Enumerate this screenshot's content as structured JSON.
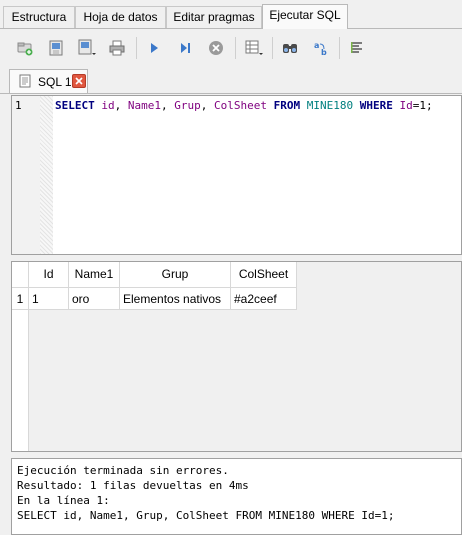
{
  "main_tabs": [
    {
      "label": "Estructura"
    },
    {
      "label": "Hoja de datos"
    },
    {
      "label": "Editar pragmas"
    },
    {
      "label": "Ejecutar SQL",
      "active": true
    }
  ],
  "toolbar": {
    "icons": [
      "open-tab-icon",
      "open-sql-icon",
      "save-sql-icon",
      "print-icon",
      "execute-all-icon",
      "execute-line-icon",
      "stop-icon",
      "save-results-icon",
      "find-icon",
      "find-replace-icon",
      "comment-icon"
    ]
  },
  "sql_tab": {
    "label": "SQL 1"
  },
  "editor": {
    "line_number": "1",
    "tokens": [
      {
        "t": "SELECT",
        "c": "kw"
      },
      {
        "t": " ",
        "c": "pl"
      },
      {
        "t": "id",
        "c": "id"
      },
      {
        "t": ", ",
        "c": "pl"
      },
      {
        "t": "Name1",
        "c": "id"
      },
      {
        "t": ", ",
        "c": "pl"
      },
      {
        "t": "Grup",
        "c": "id"
      },
      {
        "t": ", ",
        "c": "pl"
      },
      {
        "t": "ColSheet",
        "c": "id"
      },
      {
        "t": " ",
        "c": "pl"
      },
      {
        "t": "FROM",
        "c": "kw"
      },
      {
        "t": " ",
        "c": "pl"
      },
      {
        "t": "MINE180",
        "c": "tbl"
      },
      {
        "t": " ",
        "c": "pl"
      },
      {
        "t": "WHERE",
        "c": "kw"
      },
      {
        "t": " ",
        "c": "pl"
      },
      {
        "t": "Id",
        "c": "id"
      },
      {
        "t": "=1;",
        "c": "pl"
      }
    ]
  },
  "results": {
    "columns": [
      "Id",
      "Name1",
      "Grup",
      "ColSheet"
    ],
    "rows": [
      {
        "row_number": "1",
        "cells": [
          "1",
          "oro",
          "Elementos nativos",
          "#a2ceef"
        ]
      }
    ]
  },
  "messages": [
    "Ejecución terminada sin errores.",
    "Resultado: 1 filas devueltas en 4ms",
    "En la línea 1:",
    "SELECT id, Name1, Grup, ColSheet FROM MINE180 WHERE Id=1;"
  ]
}
